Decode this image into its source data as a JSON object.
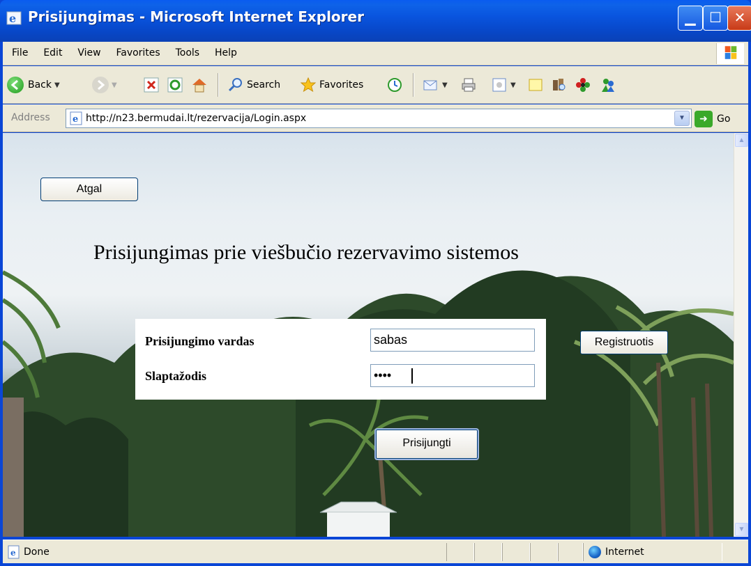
{
  "window": {
    "title": "Prisijungimas - Microsoft Internet Explorer"
  },
  "menu": {
    "items": [
      "File",
      "Edit",
      "View",
      "Favorites",
      "Tools",
      "Help"
    ]
  },
  "toolbar": {
    "back_label": "Back",
    "search_label": "Search",
    "favorites_label": "Favorites"
  },
  "address": {
    "label": "Address",
    "url": "http://n23.bermudai.lt/rezervacija/Login.aspx",
    "go_label": "Go"
  },
  "page": {
    "back_button": "Atgal",
    "heading": "Prisijungimas prie viešbučio rezervavimo sistemos",
    "username_label": "Prisijungimo vardas",
    "username_value": "sabas",
    "password_label": "Slaptažodis",
    "password_value": "••••",
    "register_button": "Registruotis",
    "login_button": "Prisijungti"
  },
  "status": {
    "text": "Done",
    "zone": "Internet"
  },
  "colors": {
    "titlebar": "#0a54de",
    "chrome": "#ece9d8"
  }
}
